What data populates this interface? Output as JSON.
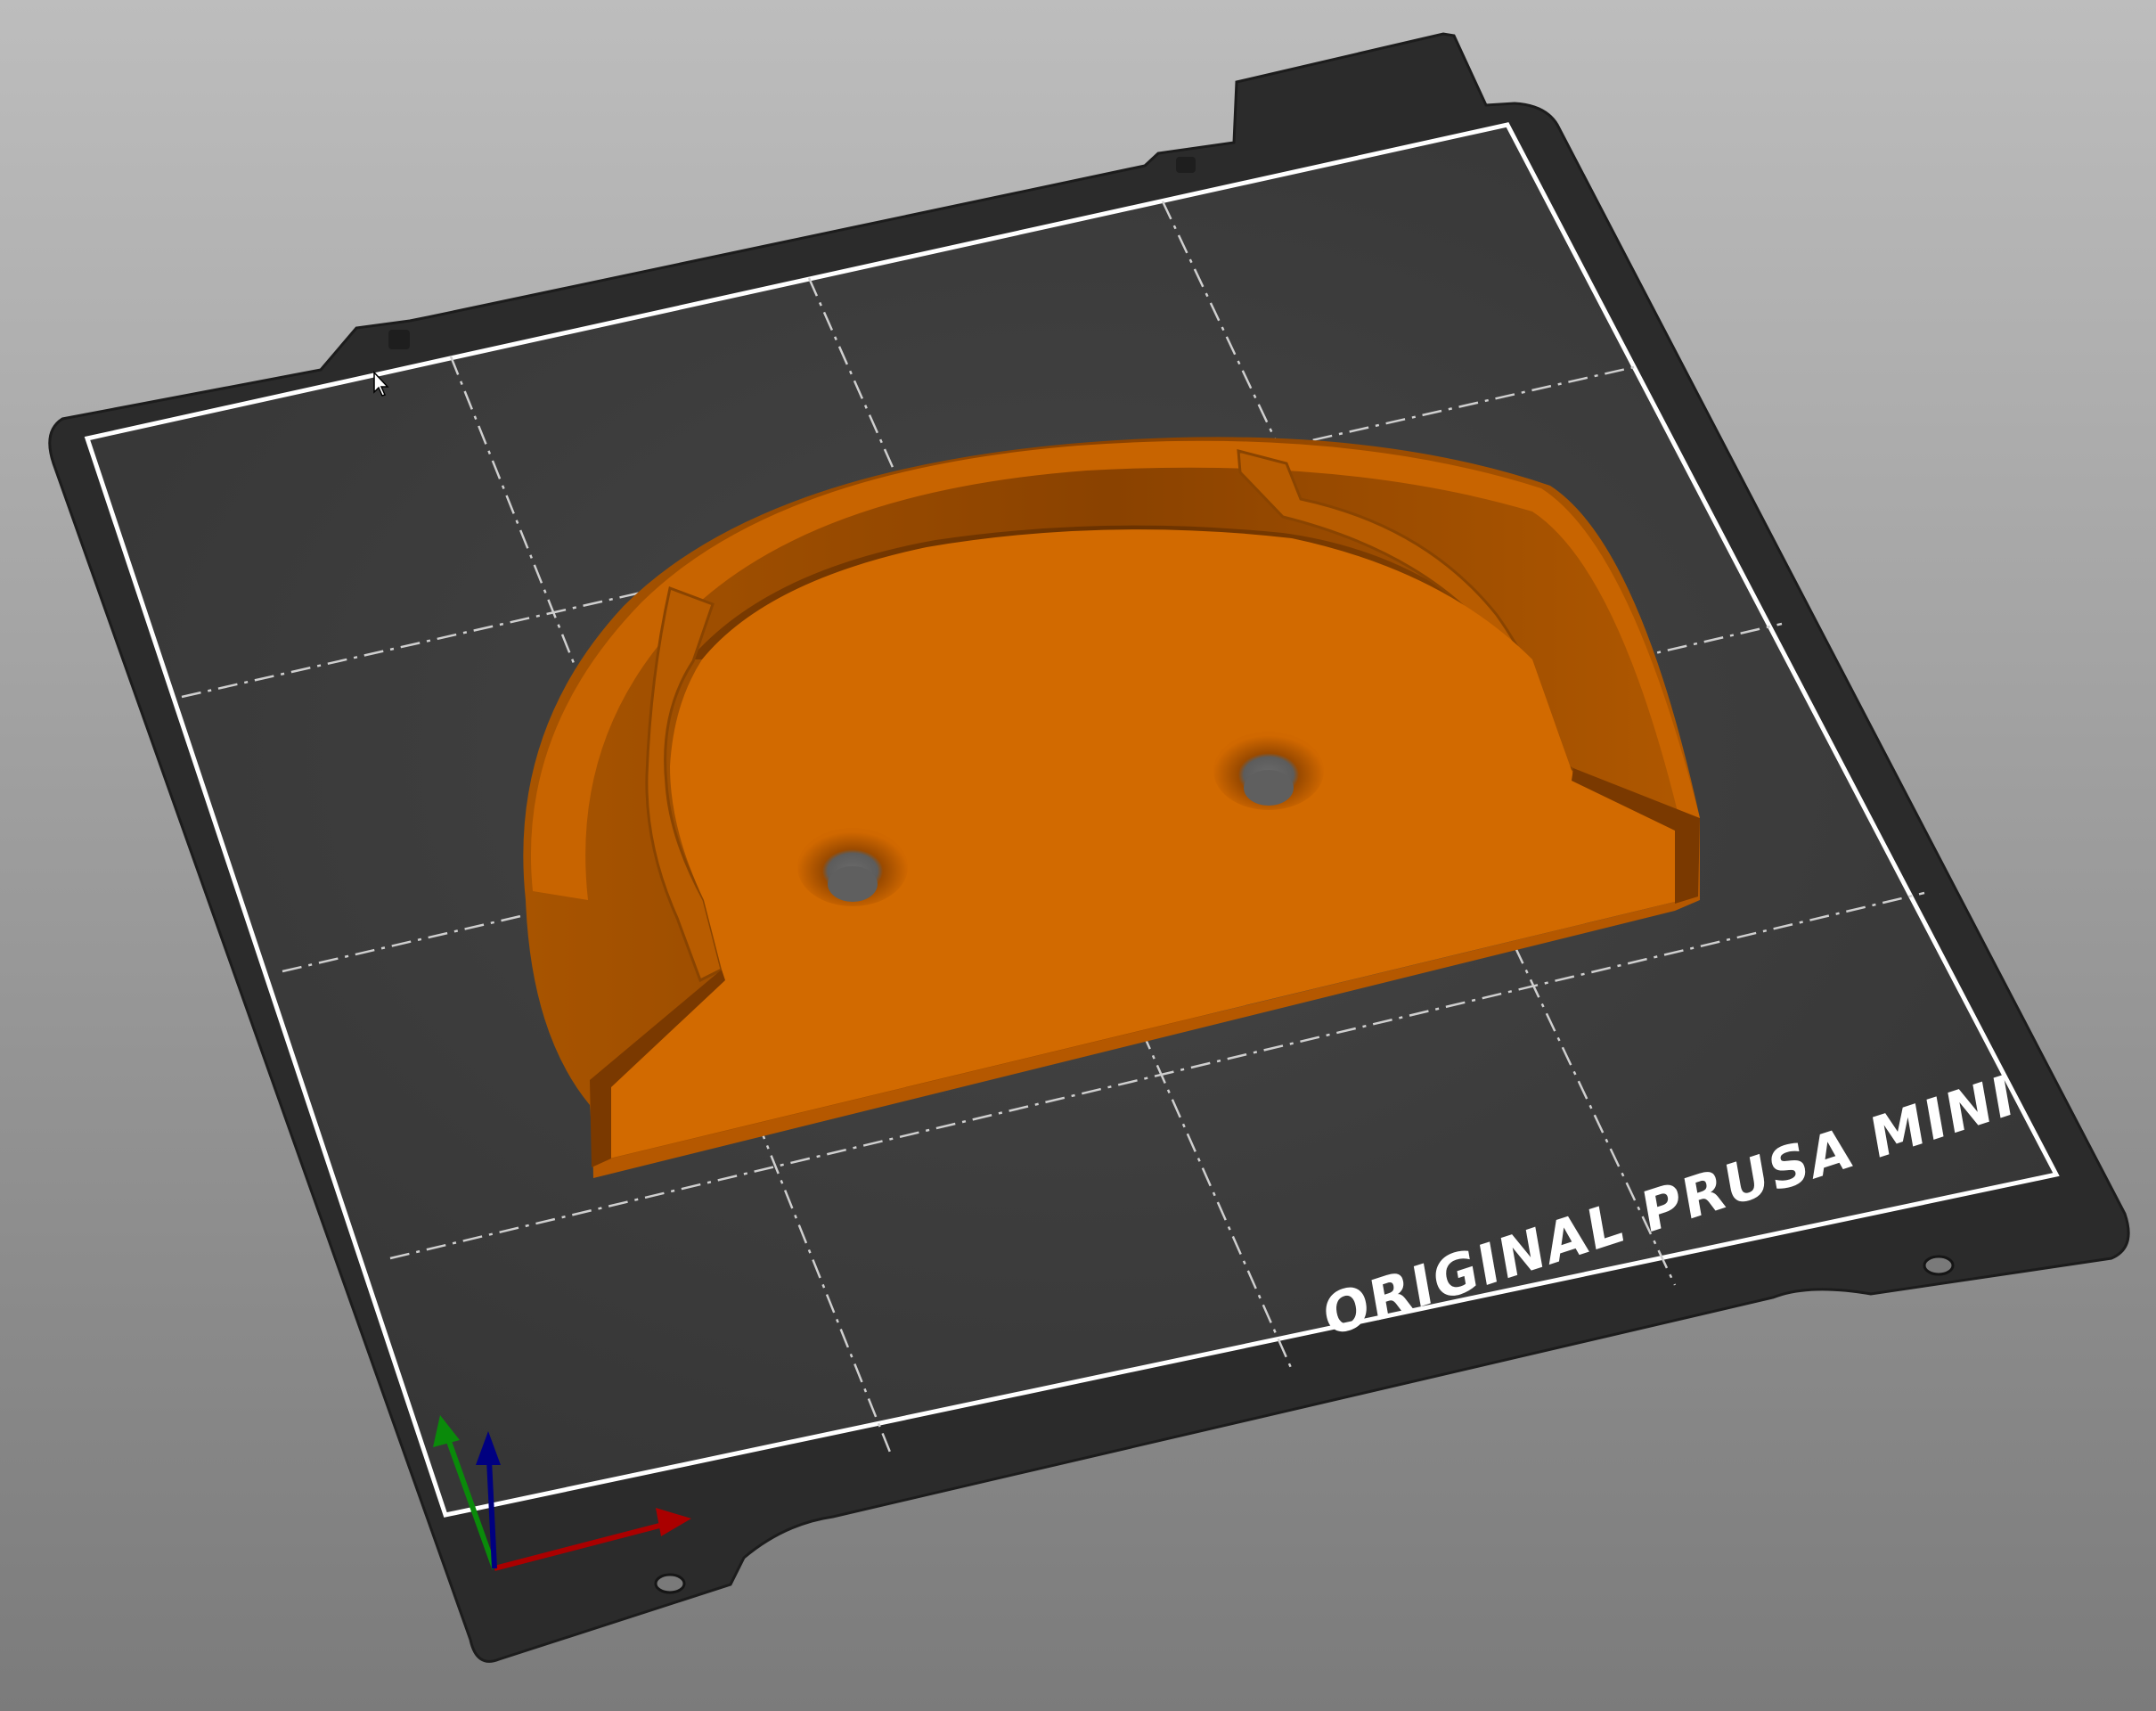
{
  "viewport": {
    "bed_label": "ORIGINAL PRUSA MINI"
  },
  "colors": {
    "background_top": "#bcbcbc",
    "background_bottom": "#7c7c7c",
    "bed_sheet": "#2b2b2b",
    "bed_surface": "#3b3b3b",
    "bed_outline": "#ffffff",
    "grid_lines": "#d0d0d0",
    "model_top": "#d16900",
    "model_wall_dark": "#8e4500",
    "model_wall_mid": "#b45a00",
    "model_inner_shadow": "#6d3400",
    "axis_x": "#b00000",
    "axis_y": "#0a8a0a",
    "axis_z": "#0a0a8a"
  },
  "icons": {
    "cursor": "mouse-cursor-icon",
    "axes": "xyz-axes-gizmo-icon"
  }
}
